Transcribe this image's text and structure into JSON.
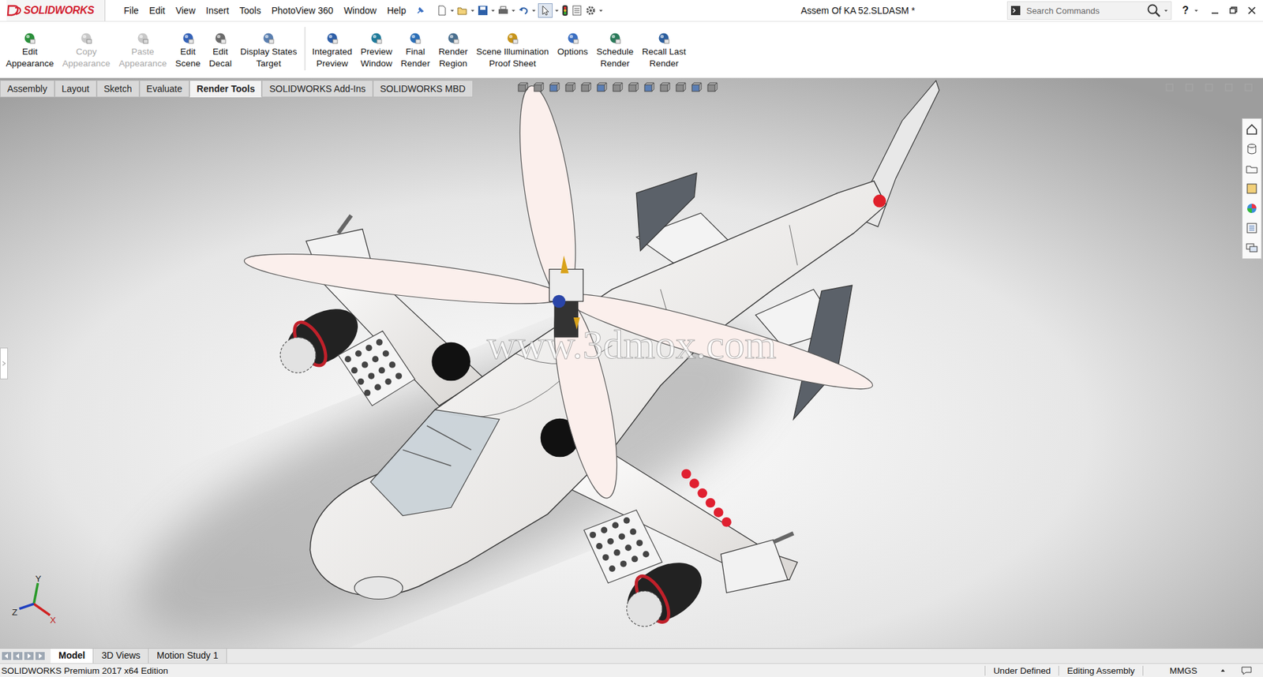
{
  "window": {
    "title": "Assem Of KA 52.SLDASM *",
    "logo": "SOLIDWORKS",
    "help": "?"
  },
  "menu": [
    "File",
    "Edit",
    "View",
    "Insert",
    "Tools",
    "PhotoView 360",
    "Window",
    "Help"
  ],
  "search": {
    "placeholder": "Search Commands"
  },
  "ribbon": {
    "groups": [
      [
        {
          "lines": [
            "Edit",
            "Appearance"
          ],
          "disabled": false
        },
        {
          "lines": [
            "Copy",
            "Appearance"
          ],
          "disabled": true
        },
        {
          "lines": [
            "Paste",
            "Appearance"
          ],
          "disabled": true
        },
        {
          "lines": [
            "Edit",
            "Scene"
          ],
          "disabled": false
        },
        {
          "lines": [
            "Edit",
            "Decal"
          ],
          "disabled": false
        },
        {
          "lines": [
            "Display States",
            "Target"
          ],
          "disabled": false
        }
      ],
      [
        {
          "lines": [
            "Integrated",
            "Preview"
          ],
          "disabled": false
        },
        {
          "lines": [
            "Preview",
            "Window"
          ],
          "disabled": false
        },
        {
          "lines": [
            "Final",
            "Render"
          ],
          "disabled": false
        },
        {
          "lines": [
            "Render",
            "Region"
          ],
          "disabled": false
        },
        {
          "lines": [
            "Scene Illumination",
            "Proof Sheet"
          ],
          "disabled": false
        },
        {
          "lines": [
            "Options"
          ],
          "disabled": false
        },
        {
          "lines": [
            "Schedule",
            "Render"
          ],
          "disabled": false
        },
        {
          "lines": [
            "Recall Last",
            "Render"
          ],
          "disabled": false
        }
      ]
    ]
  },
  "tabs": [
    {
      "label": "Assembly",
      "selected": false
    },
    {
      "label": "Layout",
      "selected": false
    },
    {
      "label": "Sketch",
      "selected": false
    },
    {
      "label": "Evaluate",
      "selected": false
    },
    {
      "label": "Render Tools",
      "selected": true
    },
    {
      "label": "SOLIDWORKS Add-Ins",
      "selected": false
    },
    {
      "label": "SOLIDWORKS MBD",
      "selected": false
    }
  ],
  "viewport": {
    "watermark": "www.3dmox.com",
    "triad": {
      "y": "Y",
      "z": "Z",
      "x": "X"
    }
  },
  "bottom_tabs": [
    {
      "label": "Model",
      "selected": true
    },
    {
      "label": "3D Views",
      "selected": false
    },
    {
      "label": "Motion Study 1",
      "selected": false
    }
  ],
  "status_bar": {
    "edition": "SOLIDWORKS Premium 2017 x64 Edition",
    "items": [
      "Under Defined",
      "Editing Assembly",
      "MMGS"
    ]
  }
}
